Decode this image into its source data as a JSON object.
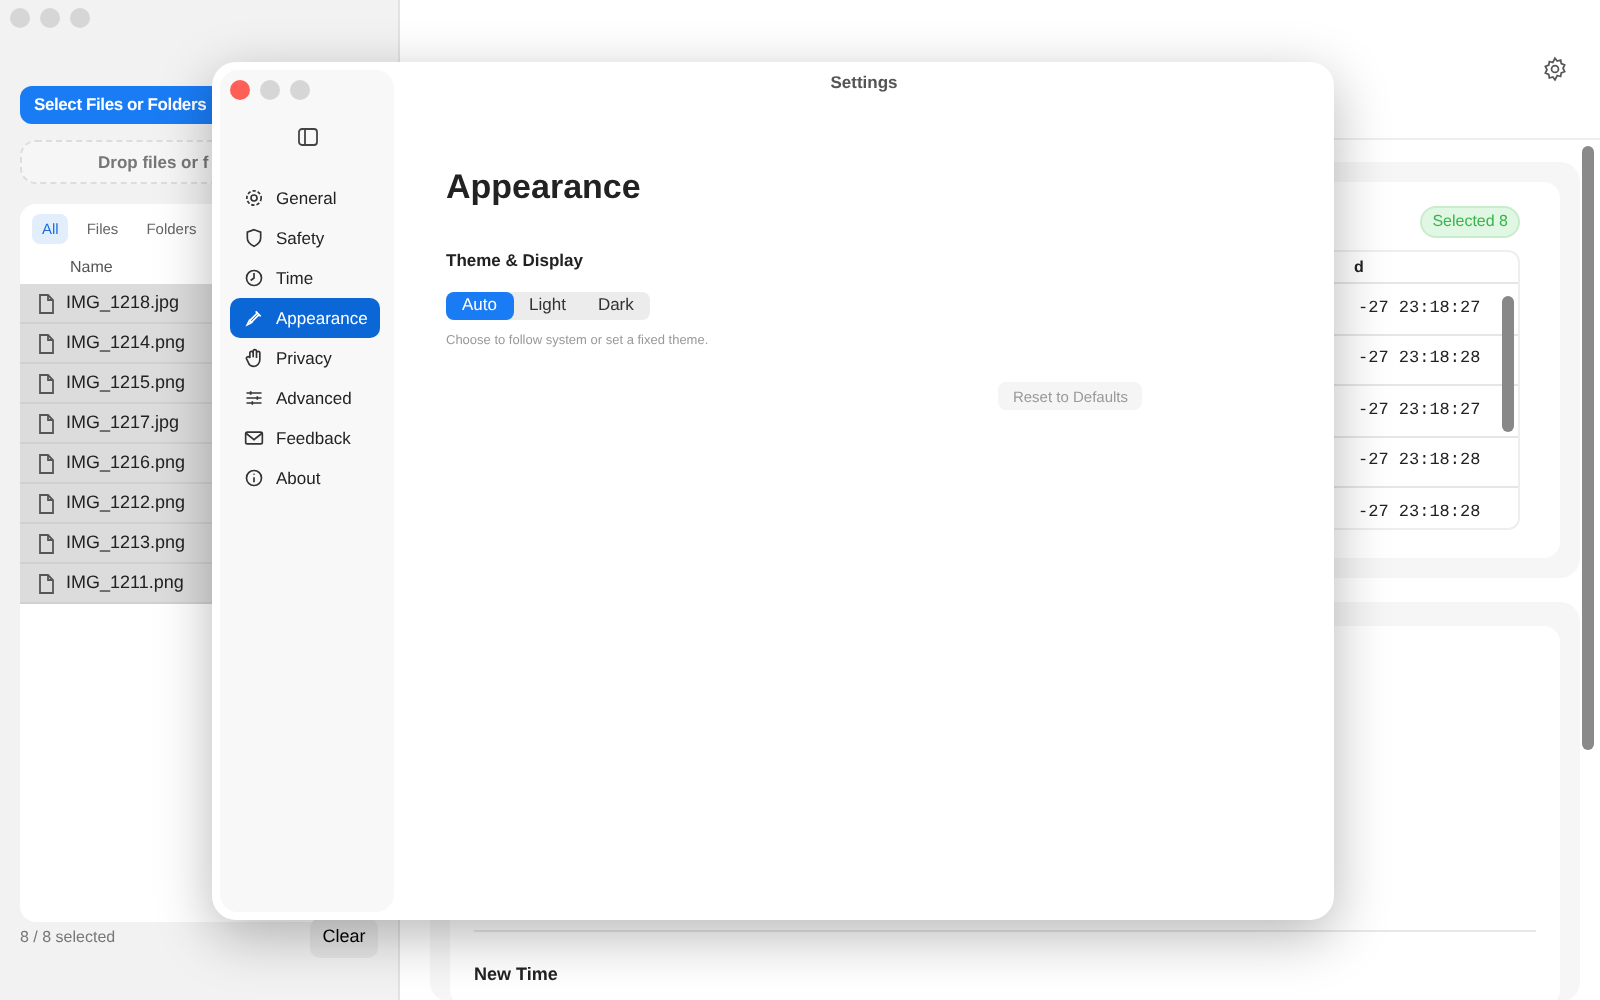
{
  "main_window": {
    "sidebar": {
      "select_button": "Select Files or Folders",
      "drop_zone": "Drop files or f",
      "filter_tabs": [
        {
          "label": "All",
          "selected": true
        },
        {
          "label": "Files",
          "selected": false
        },
        {
          "label": "Folders",
          "selected": false
        }
      ],
      "column": "Name",
      "files": [
        {
          "name": "IMG_1218.jpg",
          "selected": true
        },
        {
          "name": "IMG_1214.png",
          "selected": true
        },
        {
          "name": "IMG_1215.png",
          "selected": true
        },
        {
          "name": "IMG_1217.jpg",
          "selected": true
        },
        {
          "name": "IMG_1216.png",
          "selected": true
        },
        {
          "name": "IMG_1212.png",
          "selected": true
        },
        {
          "name": "IMG_1213.png",
          "selected": true
        },
        {
          "name": "IMG_1211.png",
          "selected": true
        }
      ],
      "selection_count": "8 / 8 selected",
      "clear_button": "Clear"
    },
    "badge": "Selected 8",
    "table": {
      "column": "d",
      "rows": [
        "-27 23:18:27",
        "-27 23:18:28",
        "-27 23:18:27",
        "-27 23:18:28",
        "-27 23:18:28"
      ]
    },
    "section_title": "New Time"
  },
  "settings": {
    "title": "Settings",
    "nav": [
      {
        "label": "General",
        "selected": false
      },
      {
        "label": "Safety",
        "selected": false
      },
      {
        "label": "Time",
        "selected": false
      },
      {
        "label": "Appearance",
        "selected": true
      },
      {
        "label": "Privacy",
        "selected": false
      },
      {
        "label": "Advanced",
        "selected": false
      },
      {
        "label": "Feedback",
        "selected": false
      },
      {
        "label": "About",
        "selected": false
      }
    ],
    "heading": "Appearance",
    "group_title": "Theme & Display",
    "theme_options": [
      {
        "label": "Auto",
        "selected": true
      },
      {
        "label": "Light",
        "selected": false
      },
      {
        "label": "Dark",
        "selected": false
      }
    ],
    "hint": "Choose to follow system or set a fixed theme.",
    "reset_button": {
      "label": "Reset to Defaults",
      "disabled": true
    }
  }
}
